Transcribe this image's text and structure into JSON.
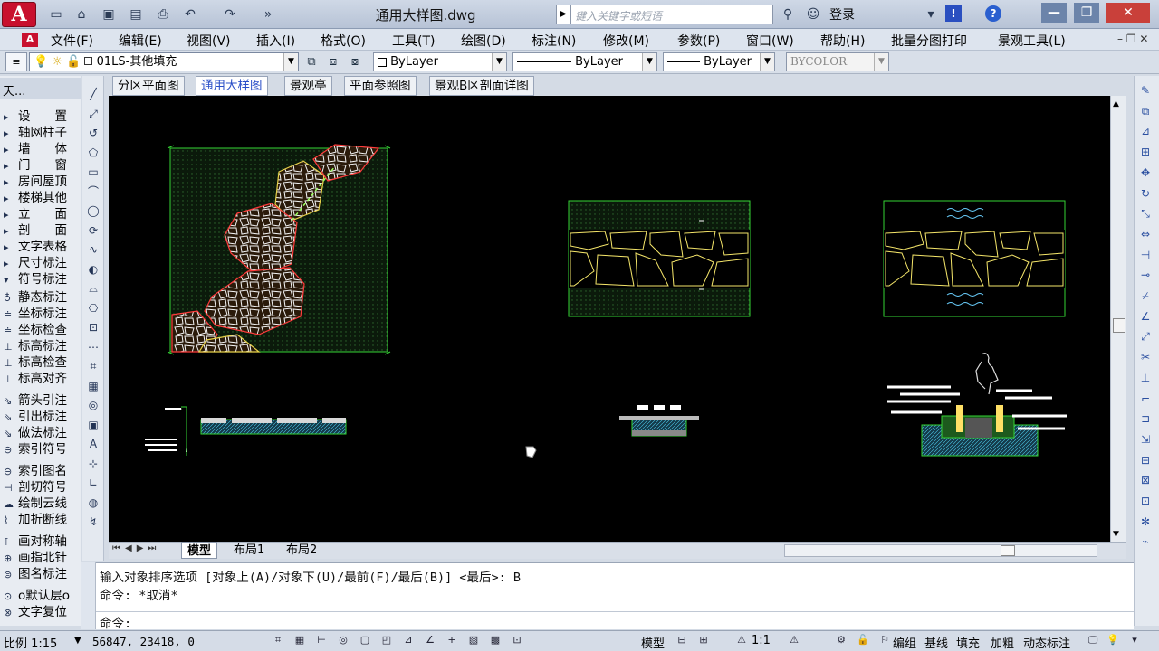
{
  "app": {
    "logo_letter": "A",
    "title": "通用大样图.dwg",
    "search_placeholder": "键入关键字或短语",
    "login_label": "登录",
    "accent_color": "#c8102e"
  },
  "menu": [
    "文件(F)",
    "编辑(E)",
    "视图(V)",
    "插入(I)",
    "格式(O)",
    "工具(T)",
    "绘图(D)",
    "标注(N)",
    "修改(M)",
    "参数(P)",
    "窗口(W)",
    "帮助(H)",
    "批量分图打印",
    "景观工具(L)"
  ],
  "toolbar": {
    "layer_value": "01LS-其他填充",
    "color_value": "ByLayer",
    "linetype_value": "ByLayer",
    "lineweight_value": "ByLayer",
    "plotstyle_value": "BYCOLOR"
  },
  "left_panel": {
    "header": "天...",
    "items": [
      "设　　置",
      "轴网柱子",
      "墙　　体",
      "门　　窗",
      "房间屋顶",
      "楼梯其他",
      "立　　面",
      "剖　　面",
      "文字表格",
      "尺寸标注",
      "符号标注",
      "静态标注",
      "坐标标注",
      "坐标检查",
      "标高标注",
      "标高检查",
      "标高对齐",
      "箭头引注",
      "引出标注",
      "做法标注",
      "索引符号",
      "索引图名",
      "剖切符号",
      "绘制云线",
      "加折断线",
      "画对称轴",
      "画指北针",
      "图名标注",
      "o默认层o",
      "文字复位"
    ]
  },
  "drawing_tabs": [
    "分区平面图",
    "通用大样图",
    "景观亭",
    "平面参照图",
    "景观B区剖面详图"
  ],
  "active_drawing_tab": "通用大样图",
  "layout_tabs": [
    "模型",
    "布局1",
    "布局2"
  ],
  "command": {
    "line1": "输入对象排序选项 [对象上(A)/对象下(U)/最前(F)/最后(B)] <最后>: B",
    "line2": "命令: *取消*",
    "prompt": "命令:"
  },
  "status": {
    "scale": "比例 1:15",
    "coords": "56847, 23418, 0",
    "model_label": "模型",
    "annot_scale": "1:1",
    "right_buttons": [
      "编组",
      "基线",
      "填充",
      "加粗",
      "动态标注"
    ]
  }
}
